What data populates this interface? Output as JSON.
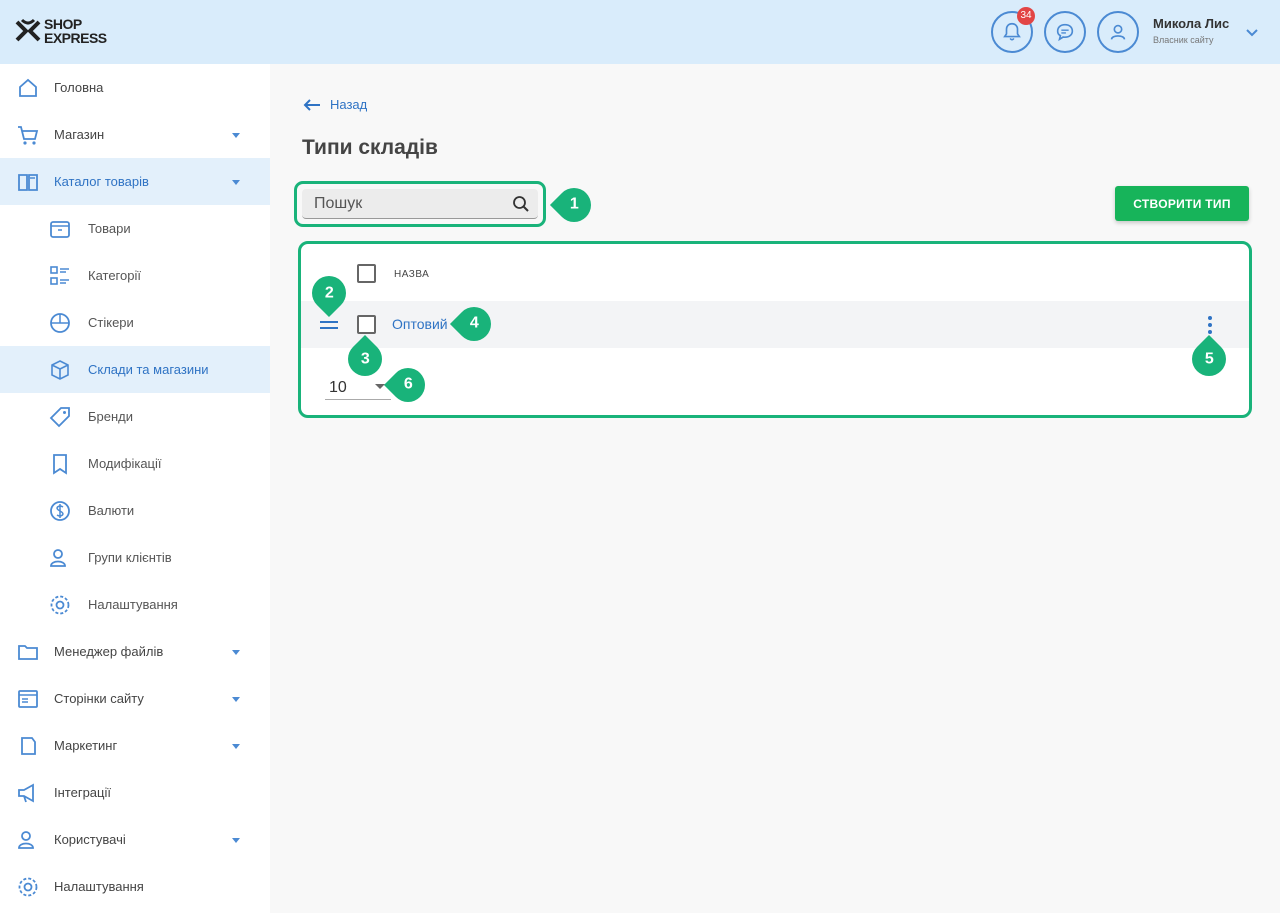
{
  "header": {
    "logo": {
      "line1": "SHOP",
      "line2": "EXPRESS"
    },
    "notifications": {
      "icon": "bell-icon",
      "count": "34"
    },
    "messages": {
      "icon": "chat-icon"
    },
    "profile": {
      "icon": "user-icon"
    },
    "user_name": "Микола Лис",
    "user_role": "Власник сайту"
  },
  "sidebar": {
    "items": [
      {
        "label": "Головна",
        "icon": "home-icon"
      },
      {
        "label": "Магазин",
        "icon": "cart-icon",
        "has_children": true
      },
      {
        "label": "Каталог товарів",
        "icon": "book-icon",
        "has_children": true,
        "expanded": true
      },
      {
        "label": "Товари",
        "icon": "box-icon",
        "sub": true
      },
      {
        "label": "Категорії",
        "icon": "category-icon",
        "sub": true
      },
      {
        "label": "Стікери",
        "icon": "sticker-icon",
        "sub": true
      },
      {
        "label": "Склади та магазини",
        "icon": "cube-icon",
        "sub": true,
        "active": true
      },
      {
        "label": "Бренди",
        "icon": "tag-icon",
        "sub": true
      },
      {
        "label": "Модифікації",
        "icon": "bookmark-icon",
        "sub": true
      },
      {
        "label": "Валюти",
        "icon": "dollar-icon",
        "sub": true
      },
      {
        "label": "Групи клієнтів",
        "icon": "users-icon",
        "sub": true
      },
      {
        "label": "Налаштування",
        "icon": "gear-icon",
        "sub": true
      },
      {
        "label": "Менеджер файлів",
        "icon": "folder-icon",
        "has_children": true
      },
      {
        "label": "Сторінки сайту",
        "icon": "page-icon",
        "has_children": true
      },
      {
        "label": "Маркетинг",
        "icon": "marketing-icon",
        "has_children": true
      },
      {
        "label": "Інтеграції",
        "icon": "megaphone-icon"
      },
      {
        "label": "Користувачі",
        "icon": "user-icon",
        "has_children": true
      },
      {
        "label": "Налаштування",
        "icon": "gear-icon"
      }
    ]
  },
  "main": {
    "back_label": "Назад",
    "title": "Типи складів",
    "search": {
      "placeholder": "Пошук"
    },
    "create_button": "СТВОРИТИ ТИП",
    "table": {
      "column_header": "НАЗВА",
      "rows": [
        {
          "name": "Оптовий"
        }
      ],
      "per_page": "10"
    }
  },
  "callouts": [
    "1",
    "2",
    "3",
    "4",
    "5",
    "6"
  ],
  "colors": {
    "accent": "#2f73c4",
    "highlight": "#19b37a",
    "create_button": "#17b45a",
    "header_bg": "#d9ecfb"
  }
}
